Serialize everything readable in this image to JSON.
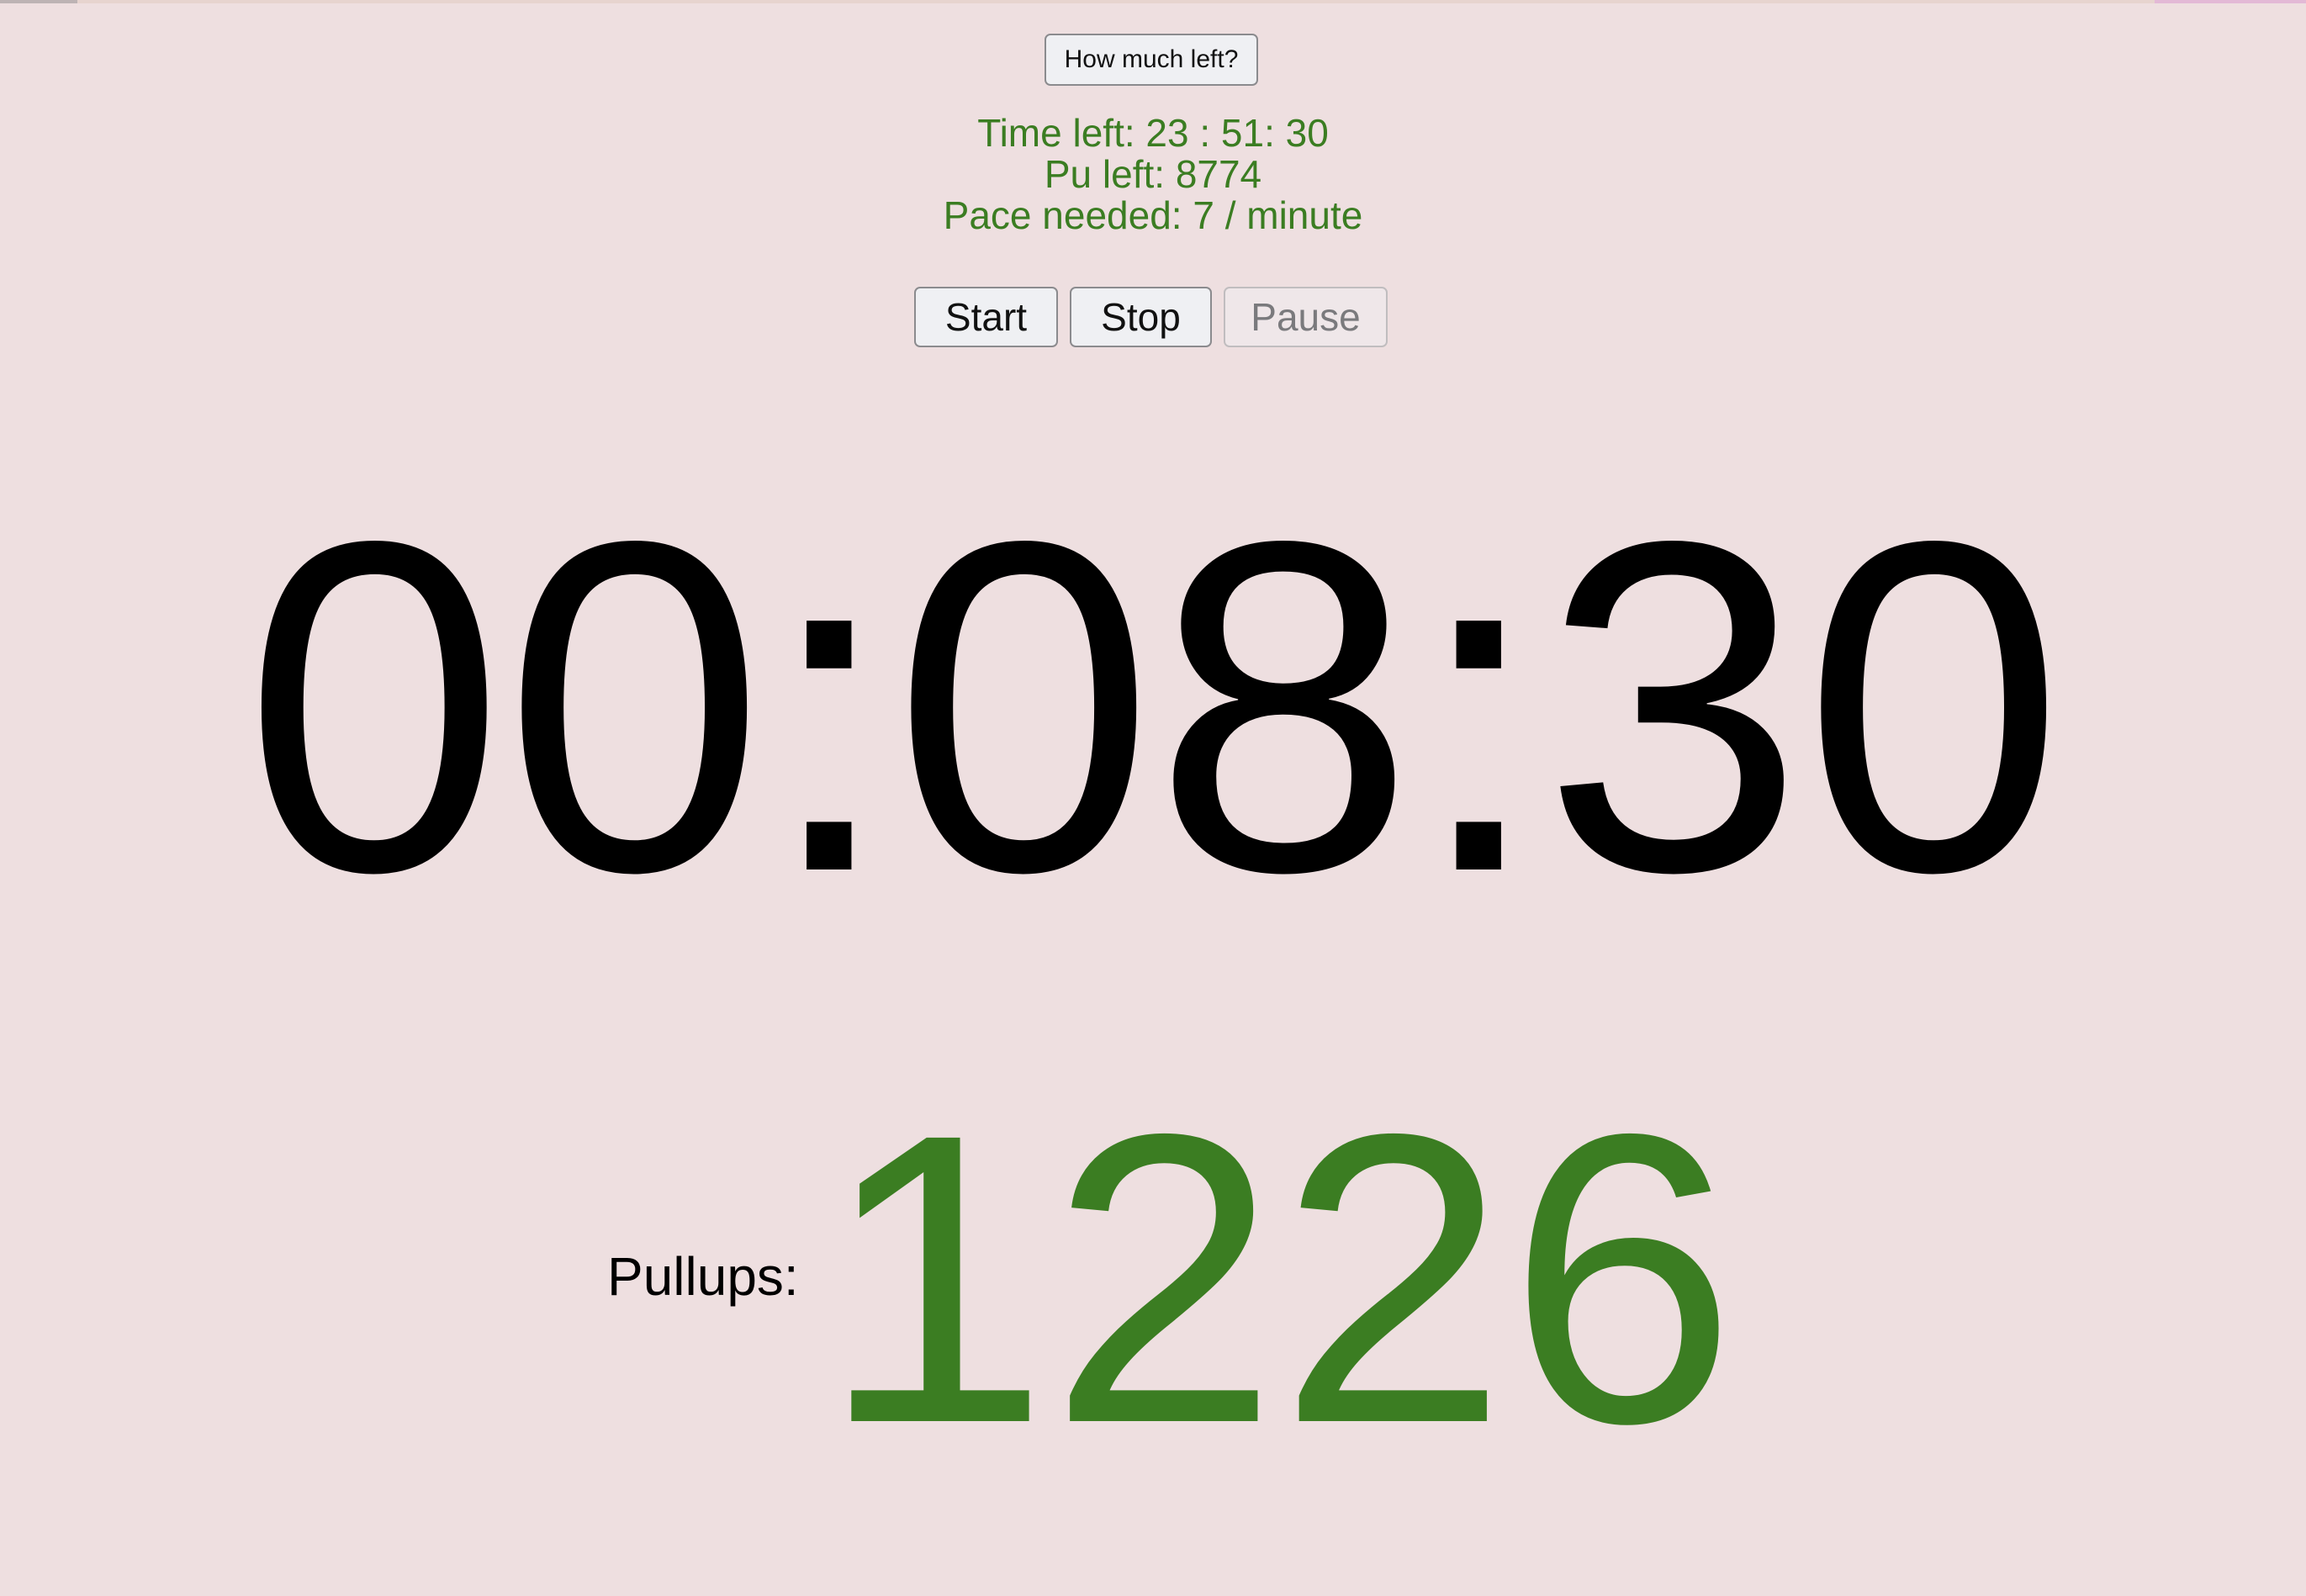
{
  "toolbar": {
    "how_much_left_label": "How much left?"
  },
  "stats": {
    "time_left": "Time left: 23 : 51: 30",
    "pu_left": "Pu left: 8774",
    "pace_needed": "Pace needed: 7 / minute"
  },
  "controls": {
    "start_label": "Start",
    "stop_label": "Stop",
    "pause_label": "Pause"
  },
  "timer": {
    "display": "00:08:30"
  },
  "pullups": {
    "label": "Pullups:",
    "count": "1226"
  },
  "colors": {
    "background": "#eedfe0",
    "accent_green": "#3b7d22",
    "text": "#000000"
  }
}
